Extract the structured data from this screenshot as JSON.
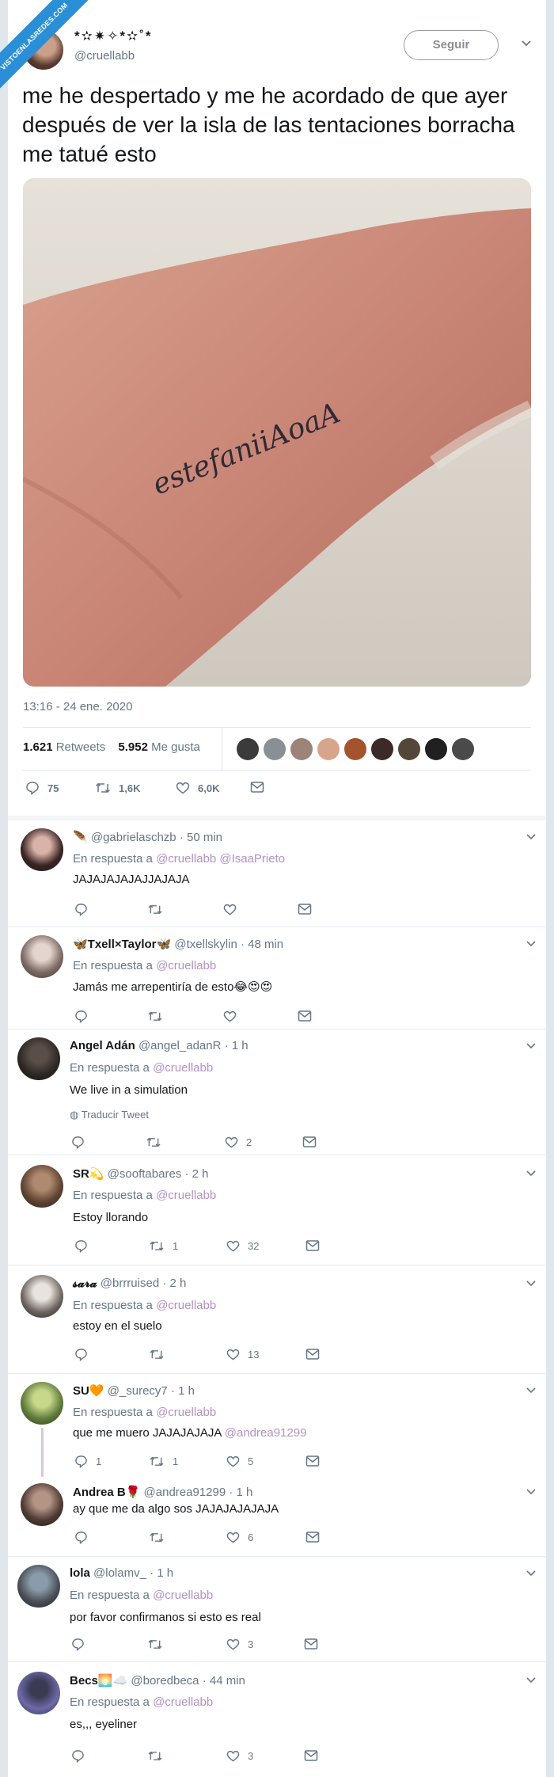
{
  "watermark": "VISTOENLASREDES.COM",
  "tweet": {
    "name": "*✫✷✧*✫˚*",
    "handle": "@cruellabb",
    "follow_label": "Seguir",
    "text": "me he despertado y me he acordado de que ayer después de ver la isla de las tentaciones borracha me tatué esto",
    "photo_tattoo_text": "estefaniiAoaA",
    "timestamp": "13:16 - 24 ene. 2020",
    "retweets_count": "1.621",
    "retweets_label": "Retweets",
    "likes_count": "5.952",
    "likes_label": "Me gusta",
    "actions": {
      "replies": "75",
      "retweets": "1,6K",
      "likes": "6,0K"
    }
  },
  "colors": {
    "mention": "#b391c4",
    "muted": "#657786",
    "thread": "#d6c8dc",
    "ribbon": "#2a8fd6"
  },
  "replies": [
    {
      "name": "🪶",
      "handle": "@gabrielaschzb",
      "time": "· 50 min",
      "in_reply_label": "En respuesta a",
      "mentions": "@cruellabb @IsaaPrieto",
      "text": "JAJAJAJAJAJJAJAJA",
      "actions": {
        "reply": "",
        "retweet": "",
        "like": ""
      }
    },
    {
      "name": "🦋Txell×Taylor🦋",
      "handle": "@txellskylin",
      "time": "· 48 min",
      "in_reply_label": "En respuesta a",
      "mentions": "@cruellabb",
      "text": "Jamás me arrepentiría de esto😂😍😍",
      "actions": {
        "reply": "",
        "retweet": "",
        "like": ""
      }
    },
    {
      "name": "Angel Adán",
      "handle": "@angel_adanR",
      "time": "· 1 h",
      "in_reply_label": "En respuesta a",
      "mentions": "@cruellabb",
      "text": "We live in a simulation",
      "translate": "Traducir Tweet",
      "actions": {
        "reply": "",
        "retweet": "",
        "like": "2"
      }
    },
    {
      "name": "SR💫",
      "handle": "@sooftabares",
      "time": "· 2 h",
      "in_reply_label": "En respuesta a",
      "mentions": "@cruellabb",
      "text": "Estoy llorando",
      "actions": {
        "reply": "",
        "retweet": "1",
        "like": "32"
      }
    },
    {
      "name": "𝓼𝓪𝓻𝓪",
      "handle": "@brrruised",
      "time": "· 2 h",
      "in_reply_label": "En respuesta a",
      "mentions": "@cruellabb",
      "text": "estoy en el suelo",
      "actions": {
        "reply": "",
        "retweet": "",
        "like": "13"
      }
    },
    {
      "name": "SU🧡",
      "handle": "@_surecy7",
      "time": "· 1 h",
      "in_reply_label": "En respuesta a",
      "mentions": "@cruellabb",
      "text": "que me muero JAJAJAJAJA",
      "text_mention": "@andrea91299",
      "actions": {
        "reply": "1",
        "retweet": "1",
        "like": "5"
      }
    },
    {
      "name": "Andrea B🌹",
      "handle": "@andrea91299",
      "time": "· 1 h",
      "text": "ay que me da algo sos JAJAJAJAJAJA",
      "actions": {
        "reply": "",
        "retweet": "",
        "like": "6"
      }
    },
    {
      "name": "lola",
      "handle": "@lolamv_",
      "time": "· 1 h",
      "in_reply_label": "En respuesta a",
      "mentions": "@cruellabb",
      "text": "por favor confirmanos si esto es real",
      "actions": {
        "reply": "",
        "retweet": "",
        "like": "3"
      }
    },
    {
      "name": "Becs🌅☁️",
      "handle": "@boredbeca",
      "time": "· 44 min",
      "in_reply_label": "En respuesta a",
      "mentions": "@cruellabb",
      "text": "es,,, eyeliner",
      "actions": {
        "reply": "",
        "retweet": "",
        "like": "3"
      }
    }
  ]
}
